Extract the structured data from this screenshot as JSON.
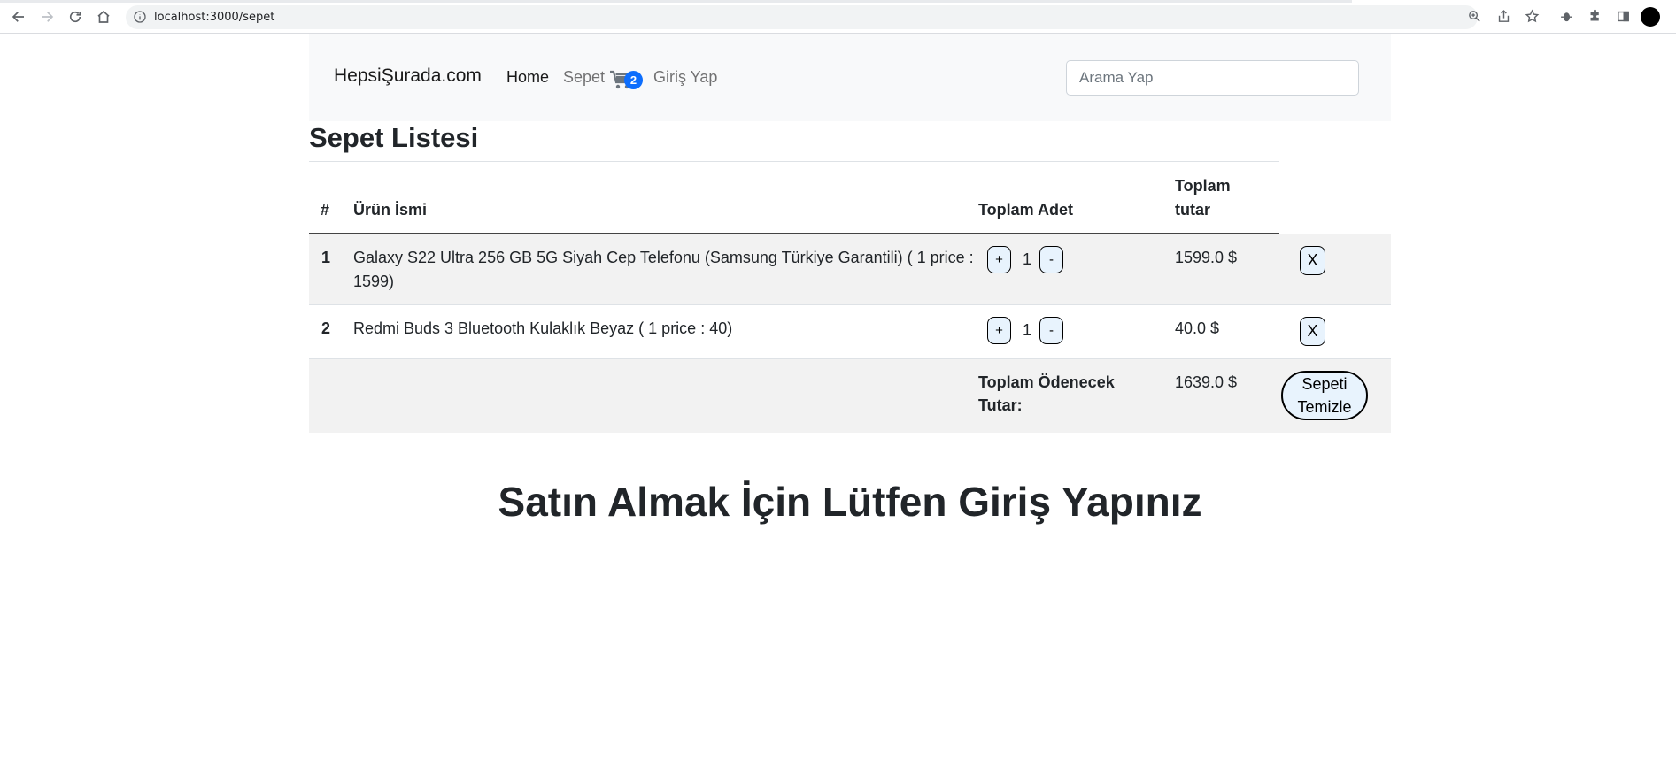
{
  "browser": {
    "url": "localhost:3000/sepet"
  },
  "navbar": {
    "brand": "HepsiŞurada.com",
    "links": [
      "Home",
      "Sepet",
      "Giriş Yap"
    ],
    "cart_count": "2",
    "search_placeholder": "Arama Yap"
  },
  "page": {
    "title": "Sepet Listesi",
    "login_message": "Satın Almak İçin Lütfen Giriş Yapınız"
  },
  "table": {
    "headers": {
      "index": "#",
      "name": "Ürün İsmi",
      "quantity": "Toplam Adet",
      "total_line1": "Toplam",
      "total_line2": "tutar"
    },
    "rows": [
      {
        "index": "1",
        "name_line1": "Galaxy S22 Ultra 256 GB 5G Siyah Cep Telefonu (Samsung Türkiye Garantili) ( 1 price :",
        "name_line2": "1599)",
        "qty": "1",
        "total": "1599.0 $",
        "plus": "+",
        "minus": "-",
        "remove": "X"
      },
      {
        "index": "2",
        "name_line1": "Redmi Buds 3 Bluetooth Kulaklık Beyaz ( 1 price : 40)",
        "qty": "1",
        "total": "40.0 $",
        "plus": "+",
        "minus": "-",
        "remove": "X"
      }
    ],
    "footer": {
      "label_line1": "Toplam Ödenecek",
      "label_line2": "Tutar:",
      "grand_total": "1639.0 $",
      "clear_line1": "Sepeti",
      "clear_line2": "Temizle"
    }
  },
  "icons": {
    "back": "arrow-left-icon",
    "forward": "arrow-right-icon",
    "reload": "reload-icon",
    "home": "home-icon",
    "info": "info-icon",
    "zoom": "zoom-icon",
    "share": "share-icon",
    "star": "star-icon",
    "extension": "puzzle-icon",
    "sidepanel": "side-panel-icon",
    "cart": "cart-icon"
  }
}
